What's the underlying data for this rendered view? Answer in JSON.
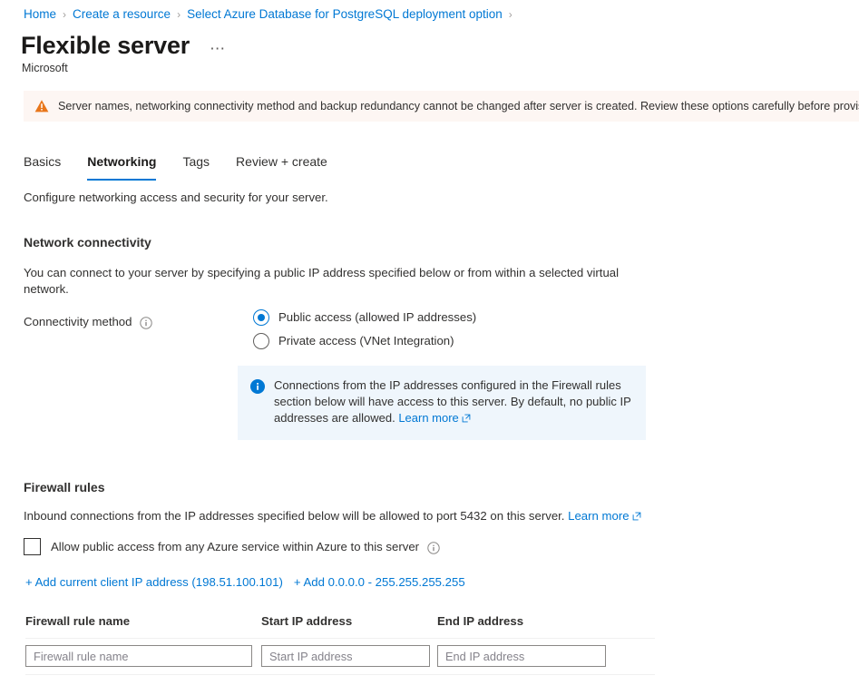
{
  "breadcrumb": {
    "items": [
      {
        "label": "Home"
      },
      {
        "label": "Create a resource"
      },
      {
        "label": "Select Azure Database for PostgreSQL deployment option"
      }
    ],
    "separator": "›"
  },
  "header": {
    "title": "Flexible server",
    "subtitle": "Microsoft",
    "more_label": "⋯"
  },
  "warning": {
    "icon": "warning-triangle-icon",
    "text": "Server names, networking connectivity method and backup redundancy cannot be changed after server is created. Review these options carefully before provisioning",
    "background": "#fdf6f3",
    "icon_color": "#d83b01"
  },
  "tabs": [
    {
      "label": "Basics",
      "active": false
    },
    {
      "label": "Networking",
      "active": true
    },
    {
      "label": "Tags",
      "active": false
    },
    {
      "label": "Review + create",
      "active": false
    }
  ],
  "tab_description": "Configure networking access and security for your server.",
  "network_connectivity": {
    "heading": "Network connectivity",
    "description": "You can connect to your server by specifying a public IP address specified below or from within a selected virtual network.",
    "field_label": "Connectivity method",
    "info_icon": "info-circle-icon",
    "options": [
      {
        "label": "Public access (allowed IP addresses)",
        "selected": true
      },
      {
        "label": "Private access (VNet Integration)",
        "selected": false
      }
    ]
  },
  "info_box": {
    "icon": "info-filled-icon",
    "text": "Connections from the IP addresses configured in the Firewall rules section below will have access to this server. By default, no public IP addresses are allowed. ",
    "link_label": "Learn more",
    "background": "#eff6fc",
    "icon_color": "#0078d4"
  },
  "firewall": {
    "heading": "Firewall rules",
    "description": "Inbound connections from the IP addresses specified below will be allowed to port 5432 on this server. ",
    "description_link": "Learn more",
    "checkbox": {
      "label": "Allow public access from any Azure service within Azure to this server",
      "checked": false,
      "info_icon": "info-circle-icon"
    },
    "actions": [
      {
        "label": "+ Add current client IP address (198.51.100.101)"
      },
      {
        "label": "+ Add 0.0.0.0 - 255.255.255.255"
      }
    ],
    "table": {
      "columns": [
        "Firewall rule name",
        "Start IP address",
        "End IP address"
      ],
      "rows": [
        {
          "rule_name_value": "",
          "rule_name_placeholder": "Firewall rule name",
          "start_ip_value": "",
          "start_ip_placeholder": "Start IP address",
          "end_ip_value": "",
          "end_ip_placeholder": "End IP address"
        }
      ]
    }
  },
  "colors": {
    "accent": "#0078d4",
    "text": "#323130",
    "warning_bg": "#fdf6f3",
    "info_bg": "#eff6fc"
  }
}
